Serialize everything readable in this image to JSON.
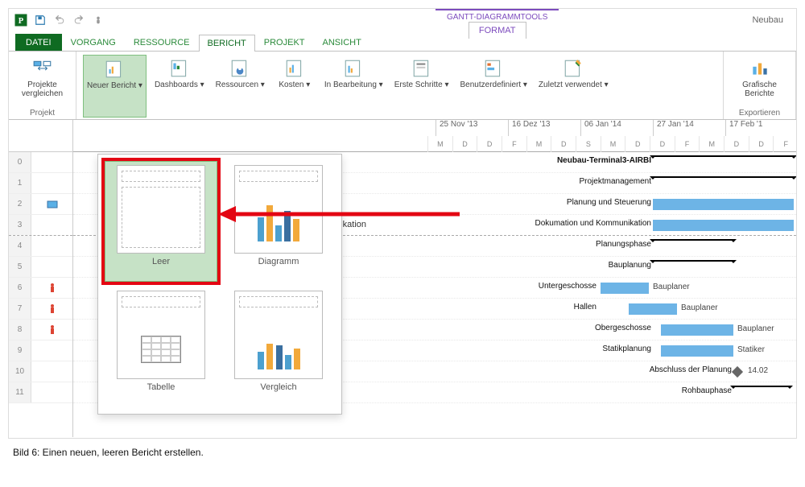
{
  "doc_title": "Neubau",
  "contextual_title": "GANTT-DIAGRAMMTOOLS",
  "tabs": {
    "file": "DATEI",
    "vorgang": "VORGANG",
    "ressource": "RESSOURCE",
    "bericht": "BERICHT",
    "projekt": "PROJEKT",
    "ansicht": "ANSICHT",
    "format": "FORMAT"
  },
  "ribbon": {
    "projekt": {
      "compare": "Projekte vergleichen",
      "group": "Projekt"
    },
    "view": {
      "new_report": "Neuer Bericht ▾",
      "dashboards": "Dashboards ▾",
      "ressourcen": "Ressourcen ▾",
      "kosten": "Kosten ▾",
      "in_bearbeitung": "In Bearbeitung ▾",
      "erste_schritte": "Erste Schritte ▾",
      "benutzerdefiniert": "Benutzerdefiniert ▾",
      "zuletzt": "Zuletzt verwendet ▾",
      "grafische": "Grafische Berichte",
      "group_export": "Exportieren"
    }
  },
  "report_options": {
    "leer": "Leer",
    "diagramm": "Diagramm",
    "tabelle": "Tabelle",
    "vergleich": "Vergleich"
  },
  "timeline": {
    "dates": [
      "25 Nov '13",
      "16 Dez '13",
      "06 Jan '14",
      "27 Jan '14",
      "17 Feb '1"
    ],
    "days": [
      "M",
      "D",
      "D",
      "F",
      "M",
      "D",
      "S",
      "M",
      "D",
      "D",
      "F",
      "M",
      "D",
      "D",
      "F"
    ]
  },
  "tasks": {
    "t0": "Neubau-Terminal3-AIRBI",
    "t1": "Projektmanagement",
    "t2": "Planung und Steuerung",
    "t3": "Dokumation und Kommunikation",
    "t4": "Planungsphase",
    "t5": "Bauplanung",
    "t6": "Untergeschosse",
    "t6r": "Bauplaner",
    "t7": "Hallen",
    "t7r": "Bauplaner",
    "t8": "Obergeschosse",
    "t8r": "Bauplaner",
    "t9": "Statikplanung",
    "t9r": "Statiker",
    "t10": "Abschluss der Planung",
    "t10d": "14.02",
    "t11": "Rohbauphase"
  },
  "row_numbers": [
    "0",
    "1",
    "2",
    "3",
    "4",
    "5",
    "6",
    "7",
    "8",
    "9",
    "10",
    "11"
  ],
  "visible_text_fragment": "unikation",
  "caption": "Bild 6: Einen neuen, leeren Bericht erstellen."
}
